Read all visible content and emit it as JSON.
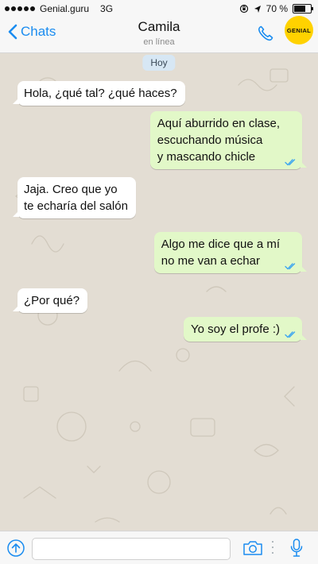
{
  "status_bar": {
    "carrier": "Genial.guru",
    "network": "3G",
    "battery_pct": "70 %",
    "battery_level": 0.7
  },
  "header": {
    "back_label": "Chats",
    "contact_name": "Camila",
    "contact_status": "en línea",
    "brand_badge": "GENIAL"
  },
  "chat": {
    "date_label": "Hoy",
    "messages": [
      {
        "dir": "in",
        "lines": [
          "Hola, ¿qué tal? ¿qué haces?"
        ]
      },
      {
        "dir": "out",
        "lines": [
          "Aquí aburrido en clase,",
          "escuchando música",
          "y mascando chicle"
        ]
      },
      {
        "dir": "in",
        "lines": [
          "Jaja. Creo que yo",
          "te echaría del salón"
        ]
      },
      {
        "dir": "out",
        "lines": [
          "Algo me dice que a mí",
          "no me van a echar"
        ]
      },
      {
        "dir": "in",
        "lines": [
          "¿Por qué?"
        ]
      },
      {
        "dir": "out",
        "lines": [
          "Yo soy el profe :)"
        ]
      }
    ]
  },
  "input_bar": {
    "message_value": ""
  },
  "icons": {
    "back": "chevron-left-icon",
    "call": "phone-icon",
    "attach": "arrow-up-circle-icon",
    "camera": "camera-icon",
    "mic": "microphone-icon",
    "read_receipt": "double-check-icon"
  },
  "colors": {
    "accent": "#1a8cf0",
    "incoming_bubble": "#ffffff",
    "outgoing_bubble": "#e2f8c8",
    "brand": "#ffd200",
    "chat_bg": "#e3ddd3"
  }
}
